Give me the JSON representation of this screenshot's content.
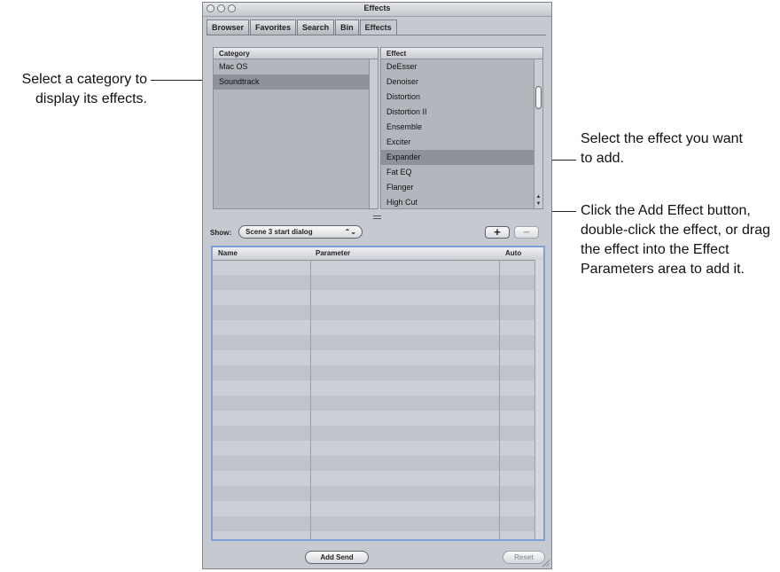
{
  "window": {
    "title": "Effects"
  },
  "tabs": [
    "Browser",
    "Favorites",
    "Search",
    "Bin",
    "Effects"
  ],
  "active_tab": "Effects",
  "category_list": {
    "header": "Category",
    "items": [
      "Mac OS",
      "Soundtrack"
    ],
    "selected": "Soundtrack"
  },
  "effect_list": {
    "header": "Effect",
    "items": [
      "DeEsser",
      "Denoiser",
      "Distortion",
      "Distortion II",
      "Ensemble",
      "Exciter",
      "Expander",
      "Fat EQ",
      "Flanger",
      "High Cut"
    ],
    "selected": "Expander"
  },
  "show": {
    "label": "Show:",
    "value": "Scene 3 start dialog",
    "updown": "⌃⌄"
  },
  "buttons": {
    "add": "+",
    "remove": "−",
    "add_send": "Add Send",
    "reset": "Reset"
  },
  "parameters_table": {
    "columns": [
      "Name",
      "Parameter",
      "Auto"
    ],
    "rows": []
  },
  "callouts": {
    "category": "Select a category to display its effects.",
    "effect": "Select the effect you want to add.",
    "add_button": "Click the Add Effect button, double-click the effect, or drag the effect into the Effect Parameters area to add it."
  },
  "icons": {
    "scroll_up": "▲",
    "scroll_down": "▼"
  },
  "colors": {
    "selection": "#8d9199",
    "focus_ring": "#7ea2d6",
    "window_bg": "#c6cad0"
  }
}
